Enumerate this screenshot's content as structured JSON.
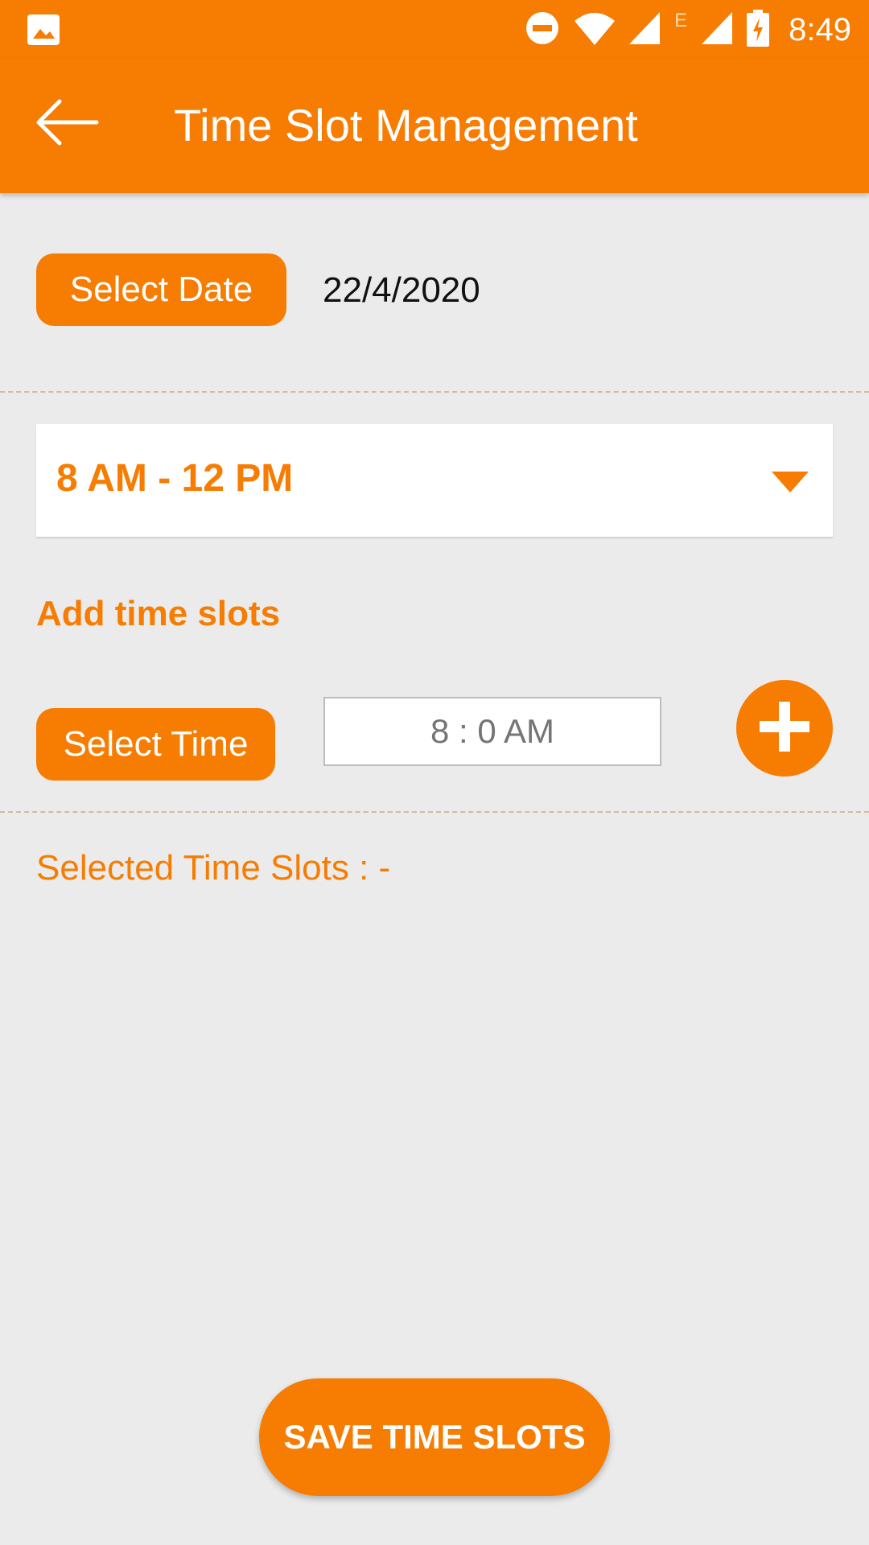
{
  "status_bar": {
    "time": "8:49",
    "network_label": "E",
    "icons": [
      "gallery-icon",
      "dnd-icon",
      "wifi-icon",
      "signal-icon",
      "signal-icon",
      "battery-charging-icon"
    ]
  },
  "app_bar": {
    "title": "Time Slot Management",
    "back_icon": "arrow-back-icon"
  },
  "date_section": {
    "button_label": "Select Date",
    "selected_date": "22/4/2020"
  },
  "slot_dropdown": {
    "selected": "8 AM - 12 PM",
    "icon": "dropdown-arrow-icon"
  },
  "add_section": {
    "label": "Add time slots",
    "time_button_label": "Select Time",
    "time_value": "8 : 0 AM",
    "add_icon": "plus-icon"
  },
  "selected_slots_label": "Selected Time Slots : -",
  "save_button_label": "SAVE TIME SLOTS",
  "colors": {
    "accent": "#f67c02",
    "background": "#ebebeb",
    "divider": "#d8b99c"
  }
}
